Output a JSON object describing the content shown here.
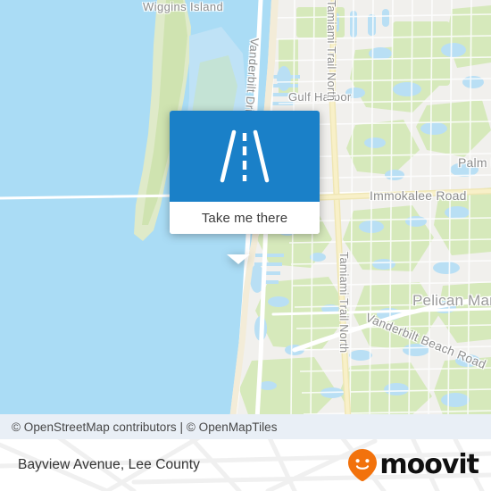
{
  "map": {
    "labels": [
      {
        "key": "wiggins",
        "text": "Wiggins Island"
      },
      {
        "key": "vanderbilt_dr",
        "text": "Vanderbilt Drive"
      },
      {
        "key": "gulf_harbor",
        "text": "Gulf Harbor"
      },
      {
        "key": "tamiami_north_1",
        "text": "Tamiami Trail North"
      },
      {
        "key": "tamiami_north_2",
        "text": "Tamiami Trail North"
      },
      {
        "key": "palm_river",
        "text": "Palm Ri"
      },
      {
        "key": "immokalee",
        "text": "Immokalee Road"
      },
      {
        "key": "pelican_marsh",
        "text": "Pelican Mars"
      },
      {
        "key": "vanderbilt_beach_rd",
        "text": "Vanderbilt Beach Road"
      }
    ],
    "colors": {
      "water": "#aadcf5",
      "land": "#f1f0ed",
      "park": "#d6e9bb",
      "road_major": "#ffffff",
      "road_highway": "#f7e9a8",
      "label_text": "#8d8d8d"
    }
  },
  "popup": {
    "icon_name": "road-icon",
    "button_label": "Take me there",
    "header_color": "#1a80c8",
    "body_color": "#ffffff"
  },
  "attribution": {
    "text": "© OpenStreetMap contributors | © OpenMapTiles",
    "background": "#e9eff6"
  },
  "footer": {
    "title": "Bayview Avenue, Lee County",
    "brand": {
      "name": "moovit",
      "pin_color": "#f2720c",
      "text_color": "#111111"
    }
  }
}
